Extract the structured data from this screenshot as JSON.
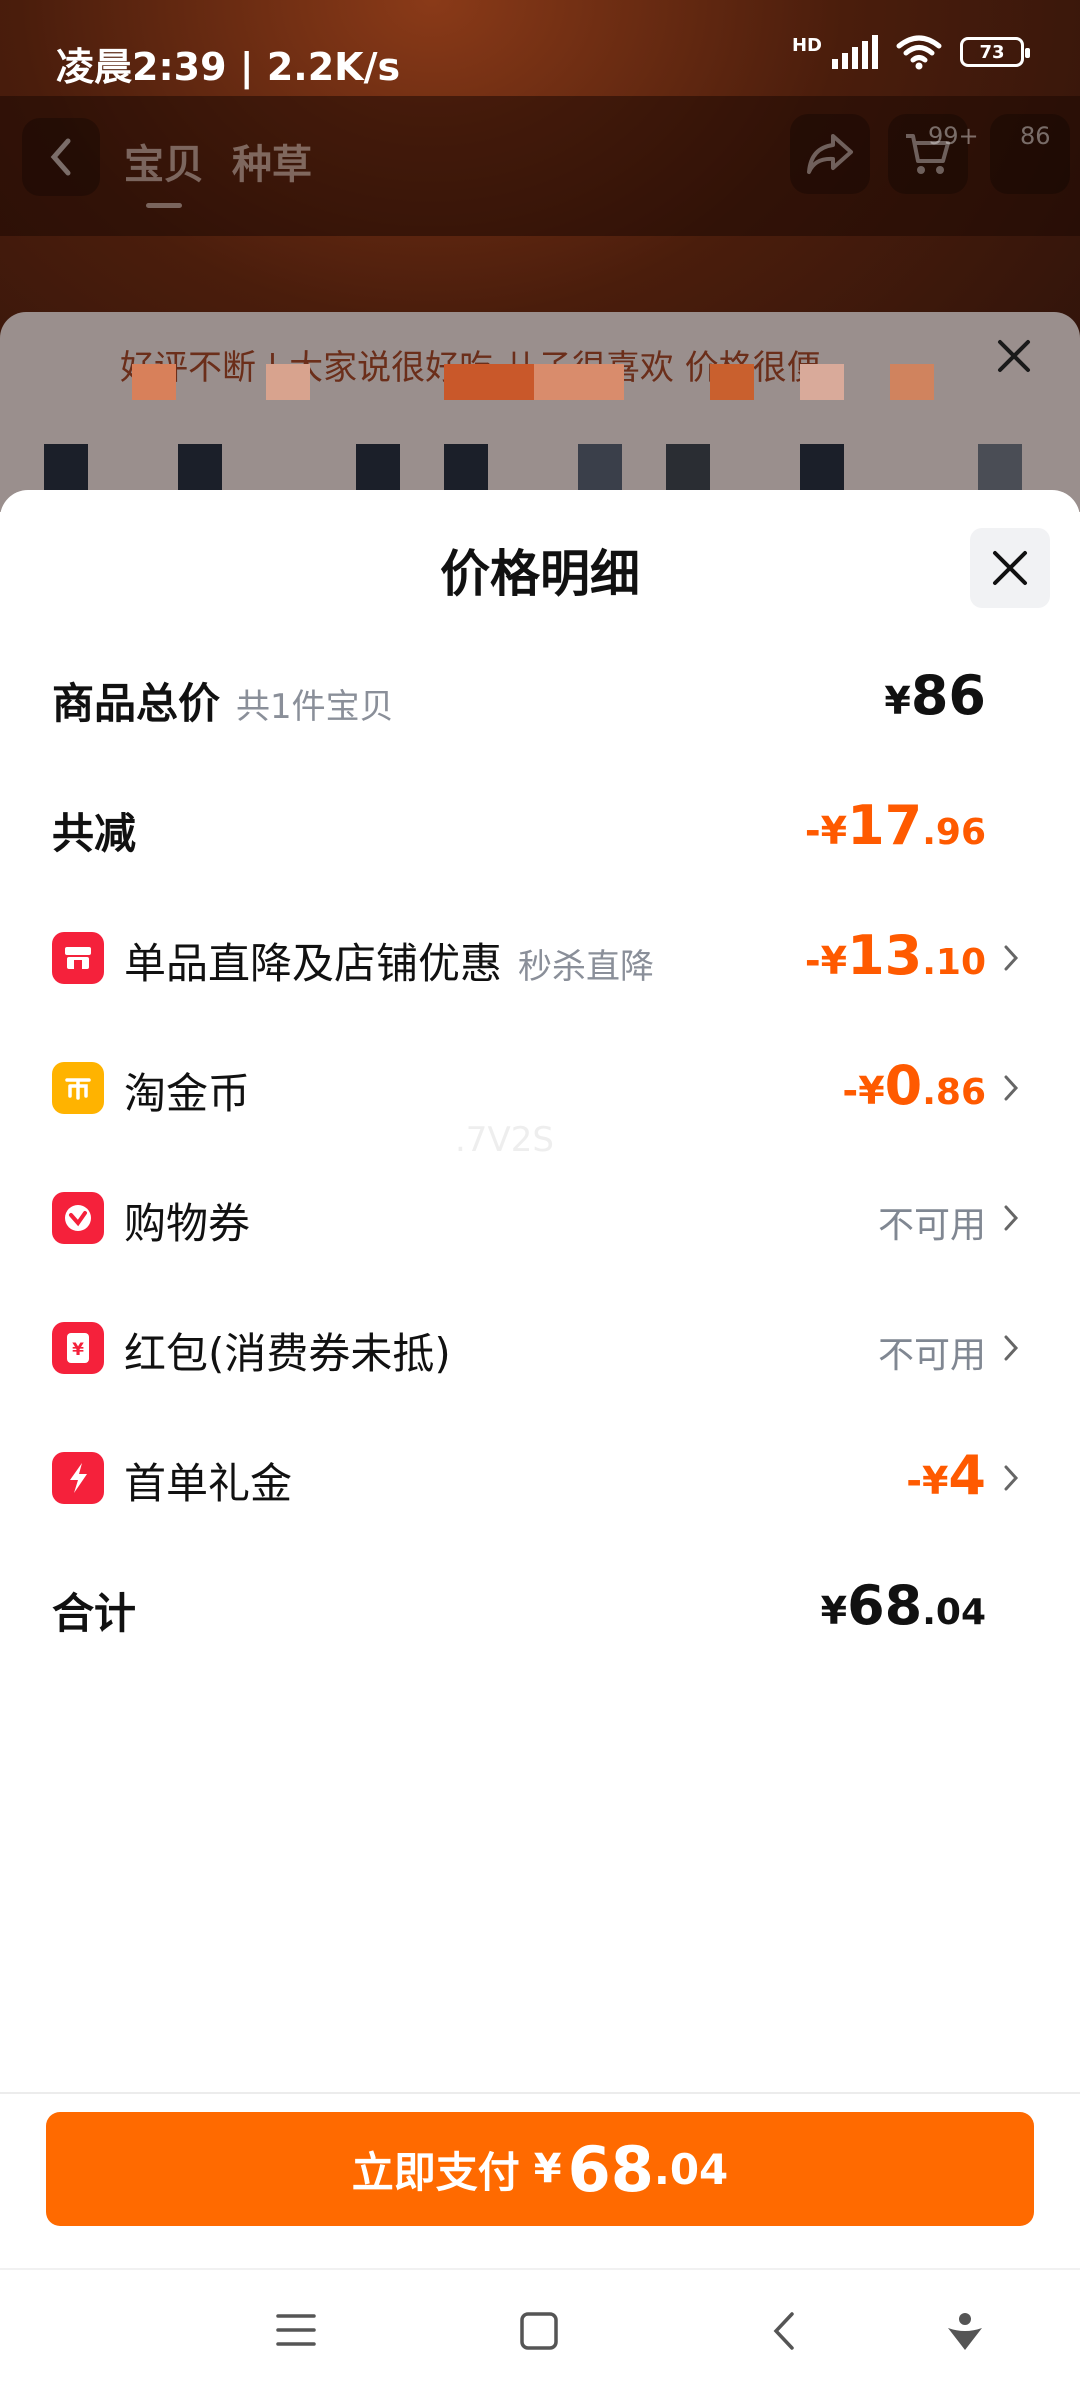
{
  "status_bar": {
    "time": "凌晨2:39 | 2.2K/s",
    "network": "HD",
    "battery": "73"
  },
  "header": {
    "tabs": [
      "宝贝",
      "种草"
    ],
    "cart_badge": "99+",
    "message_badge": "86"
  },
  "background_banner": {
    "text": "好评不断 | 大家说很好吃 儿子很喜欢 价格很便"
  },
  "sheet": {
    "title": "价格明细",
    "rows": [
      {
        "label": "商品总价",
        "sub": "共1件宝贝",
        "currency": "¥",
        "int": "86",
        "dec": ""
      },
      {
        "label": "共减",
        "currency": "-¥",
        "int": "17",
        "dec": ".96"
      },
      {
        "label": "单品直降及店铺优惠",
        "sub": "秒杀直降",
        "currency": "-¥",
        "int": "13",
        "dec": ".10",
        "icon": "store-icon"
      },
      {
        "label": "淘金币",
        "currency": "-¥",
        "int": "0",
        "dec": ".86",
        "icon": "coin-icon"
      },
      {
        "label": "购物券",
        "status": "不可用",
        "icon": "coupon-icon"
      },
      {
        "label": "红包(消费券未抵)",
        "status": "不可用",
        "icon": "red-packet-icon"
      },
      {
        "label": "首单礼金",
        "currency": "-¥",
        "int": "4",
        "dec": "",
        "icon": "gift-cash-icon"
      },
      {
        "label": "合计",
        "currency": "¥",
        "int": "68",
        "dec": ".04"
      }
    ],
    "watermark": ".7V2S"
  },
  "pay_button": {
    "label": "立即支付",
    "currency": "¥",
    "int": "68",
    "dec": ".04"
  },
  "colors": {
    "accent": "#ff6a00",
    "discount": "#ff5a00",
    "icon_red": "#f5213b",
    "icon_yellow": "#ffb300"
  }
}
